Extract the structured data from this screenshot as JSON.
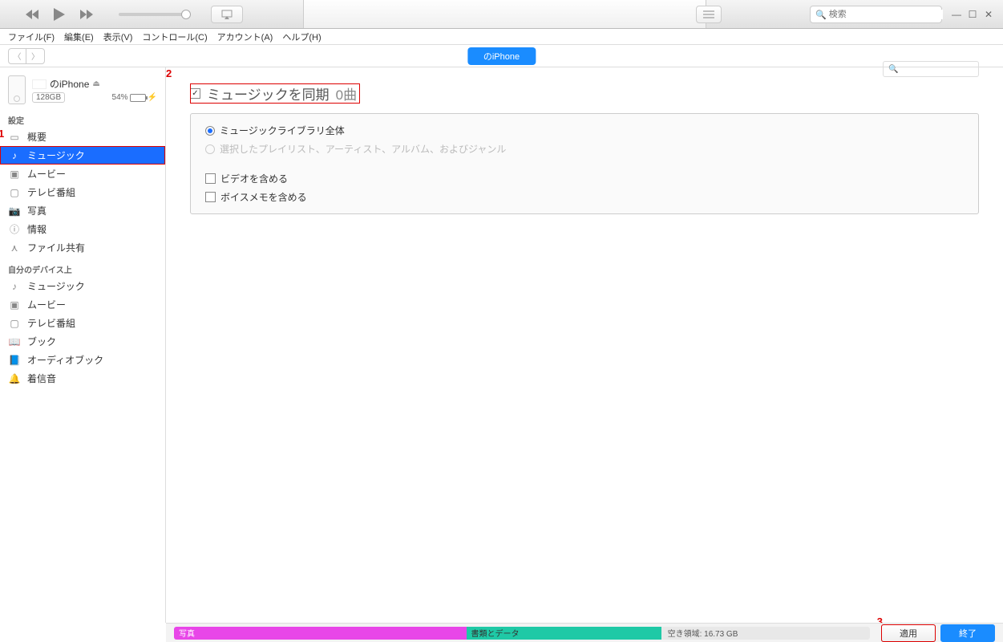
{
  "menus": [
    "ファイル(F)",
    "編集(E)",
    "表示(V)",
    "コントロール(C)",
    "アカウント(A)",
    "ヘルプ(H)"
  ],
  "search_placeholder": "検索",
  "device_tab": "のiPhone",
  "device": {
    "name": "のiPhone",
    "capacity": "128GB",
    "battery_pct": "54%"
  },
  "sidebar": {
    "settings_header": "設定",
    "settings": [
      {
        "label": "概要",
        "icon": "summary"
      },
      {
        "label": "ミュージック",
        "icon": "music",
        "selected": true
      },
      {
        "label": "ムービー",
        "icon": "movie"
      },
      {
        "label": "テレビ番組",
        "icon": "tv"
      },
      {
        "label": "写真",
        "icon": "photo"
      },
      {
        "label": "情報",
        "icon": "info"
      },
      {
        "label": "ファイル共有",
        "icon": "share"
      }
    ],
    "ondevice_header": "自分のデバイス上",
    "ondevice": [
      {
        "label": "ミュージック",
        "icon": "music"
      },
      {
        "label": "ムービー",
        "icon": "movie"
      },
      {
        "label": "テレビ番組",
        "icon": "tv"
      },
      {
        "label": "ブック",
        "icon": "book"
      },
      {
        "label": "オーディオブック",
        "icon": "audiobook"
      },
      {
        "label": "着信音",
        "icon": "ringtone"
      }
    ]
  },
  "sync": {
    "title": "ミュージックを同期",
    "count": "0曲",
    "opt_all": "ミュージックライブラリ全体",
    "opt_selected": "選択したプレイリスト、アーティスト、アルバム、およびジャンル",
    "include_video": "ビデオを含める",
    "include_voice": "ボイスメモを含める"
  },
  "storage": {
    "photo": "写真",
    "docs": "書類とデータ",
    "free": "空き領域: 16.73 GB"
  },
  "buttons": {
    "apply": "適用",
    "done": "終了"
  },
  "annotations": {
    "1": "1",
    "2": "2",
    "3": "3"
  }
}
